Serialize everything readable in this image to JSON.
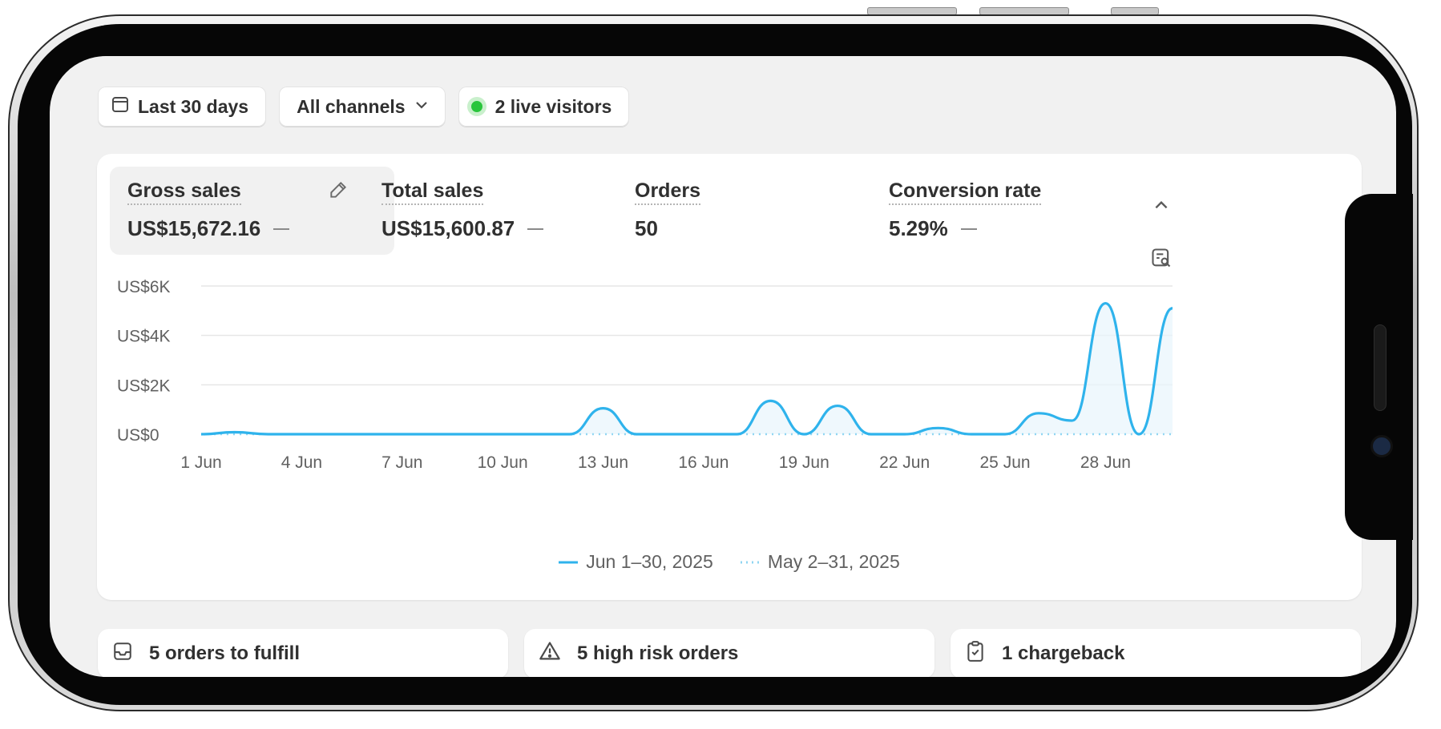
{
  "filters": {
    "date_range": "Last 30 days",
    "channel": "All channels",
    "live_visitors": "2 live visitors"
  },
  "metrics": [
    {
      "label": "Gross sales",
      "value": "US$15,672.16",
      "selected": true
    },
    {
      "label": "Total sales",
      "value": "US$15,600.87"
    },
    {
      "label": "Orders",
      "value": "50"
    },
    {
      "label": "Conversion rate",
      "value": "5.29%"
    }
  ],
  "tasks": [
    {
      "label": "5 orders to fulfill",
      "icon": "inbox-icon"
    },
    {
      "label": "5 high risk orders",
      "icon": "alert-triangle-icon"
    },
    {
      "label": "1 chargeback",
      "icon": "clipboard-check-icon"
    }
  ],
  "colors": {
    "accent": "#2fb3ec",
    "live": "#29c53c"
  },
  "chart_data": {
    "type": "area",
    "x": [
      "1 Jun",
      "2 Jun",
      "3 Jun",
      "4 Jun",
      "5 Jun",
      "6 Jun",
      "7 Jun",
      "8 Jun",
      "9 Jun",
      "10 Jun",
      "11 Jun",
      "12 Jun",
      "13 Jun",
      "14 Jun",
      "15 Jun",
      "16 Jun",
      "17 Jun",
      "18 Jun",
      "19 Jun",
      "20 Jun",
      "21 Jun",
      "22 Jun",
      "23 Jun",
      "24 Jun",
      "25 Jun",
      "26 Jun",
      "27 Jun",
      "28 Jun",
      "29 Jun",
      "30 Jun"
    ],
    "xticks": [
      "1 Jun",
      "4 Jun",
      "7 Jun",
      "10 Jun",
      "13 Jun",
      "16 Jun",
      "19 Jun",
      "22 Jun",
      "25 Jun",
      "28 Jun"
    ],
    "yticks": [
      "US$0",
      "US$2K",
      "US$4K",
      "US$6K"
    ],
    "ylim": [
      0,
      6000
    ],
    "series": [
      {
        "name": "Jun 1–30, 2025",
        "style": "solid",
        "values": [
          0,
          80,
          0,
          0,
          0,
          0,
          0,
          0,
          0,
          0,
          0,
          0,
          1050,
          0,
          0,
          0,
          0,
          1350,
          0,
          1150,
          0,
          0,
          250,
          0,
          0,
          850,
          550,
          5300,
          0,
          5100
        ]
      },
      {
        "name": "May 2–31, 2025",
        "style": "dotted",
        "values": [
          0,
          0,
          0,
          0,
          0,
          0,
          0,
          0,
          0,
          0,
          0,
          0,
          0,
          0,
          0,
          0,
          0,
          0,
          0,
          0,
          0,
          0,
          0,
          0,
          0,
          0,
          0,
          0,
          0,
          0
        ]
      }
    ],
    "legend_position": "bottom-center",
    "grid": true
  }
}
